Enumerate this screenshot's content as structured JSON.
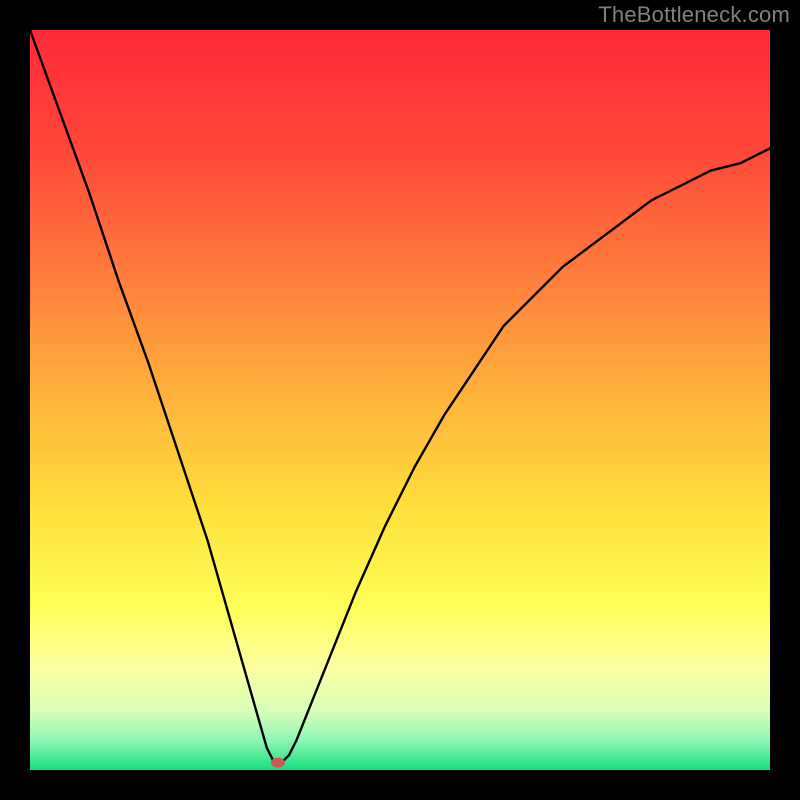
{
  "watermark": "TheBottleneck.com",
  "chart_data": {
    "type": "line",
    "title": "",
    "xlabel": "",
    "ylabel": "",
    "xlim": [
      0,
      100
    ],
    "ylim": [
      0,
      100
    ],
    "grid": false,
    "legend": false,
    "background_gradient": {
      "stops": [
        {
          "offset": 0.0,
          "color": "#ff2a3a"
        },
        {
          "offset": 0.15,
          "color": "#ff4438"
        },
        {
          "offset": 0.35,
          "color": "#ff833c"
        },
        {
          "offset": 0.5,
          "color": "#ffb43c"
        },
        {
          "offset": 0.65,
          "color": "#ffe03c"
        },
        {
          "offset": 0.78,
          "color": "#ffff57"
        },
        {
          "offset": 0.86,
          "color": "#fdffa0"
        },
        {
          "offset": 0.92,
          "color": "#d8ffb8"
        },
        {
          "offset": 0.96,
          "color": "#8cf7b4"
        },
        {
          "offset": 1.0,
          "color": "#17e07e"
        }
      ]
    },
    "series": [
      {
        "name": "bottleneck-curve",
        "color": "#000000",
        "x": [
          0,
          4,
          8,
          12,
          16,
          20,
          24,
          28,
          30,
          32,
          33,
          34,
          35,
          36,
          38,
          40,
          44,
          48,
          52,
          56,
          60,
          64,
          68,
          72,
          76,
          80,
          84,
          88,
          92,
          96,
          100
        ],
        "y": [
          100,
          89,
          78,
          66,
          55,
          43,
          31,
          17,
          10,
          3,
          1,
          1,
          2,
          4,
          9,
          14,
          24,
          33,
          41,
          48,
          54,
          60,
          64,
          68,
          71,
          74,
          77,
          79,
          81,
          82,
          84
        ]
      }
    ],
    "marker": {
      "name": "min-point",
      "x": 33.5,
      "y": 1,
      "color": "#cc5a52",
      "rx": 7,
      "ry": 5
    }
  }
}
